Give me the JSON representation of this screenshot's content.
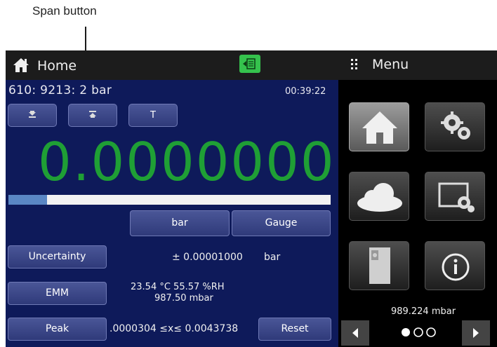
{
  "annotation": {
    "label": "Span button"
  },
  "header": {
    "title": "Home"
  },
  "menu": {
    "title": "Menu",
    "tiles": [
      "home-icon",
      "gears-icon",
      "cloud-icon",
      "display-settings-icon",
      "storage-icon",
      "info-icon"
    ],
    "barometer": "989.224 mbar",
    "page_dots": 3,
    "active_page": 0
  },
  "channel": {
    "id": "610: 9213:  2 bar",
    "time": "00:39:22"
  },
  "soft_buttons": {
    "tare": "T"
  },
  "reading": {
    "value": "0.0000000",
    "progress": 0.12
  },
  "units": {
    "unit": "bar",
    "mode": "Gauge"
  },
  "uncertainty": {
    "label": "Uncertainty",
    "value": "± 0.00001000",
    "unit": "bar"
  },
  "emm": {
    "label": "EMM",
    "line1": "23.54 °C   55.57 %RH",
    "line2": "987.50 mbar"
  },
  "peak": {
    "label": "Peak",
    "value": ".0000304 ≤x≤ 0.0043738",
    "reset": "Reset"
  },
  "colors": {
    "panel": "#0e1a5a",
    "reading": "#1f9f35",
    "bar": "#5a87c4",
    "button": "#3a4588",
    "indicator": "#35c24d"
  }
}
